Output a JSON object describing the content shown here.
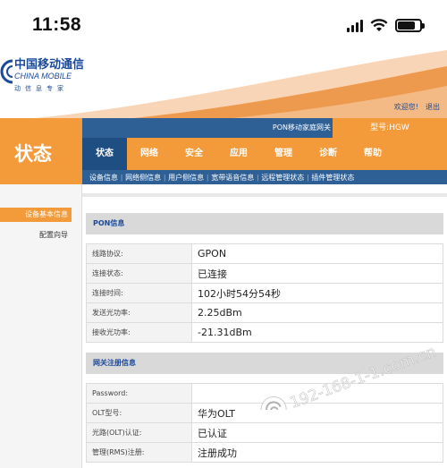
{
  "status_bar": {
    "time": "11:58"
  },
  "header": {
    "logo_cn": "中国移动通信",
    "logo_en": "CHINA MOBILE",
    "logo_slogan": "动信息专家",
    "welcome": "欢迎您!",
    "logout": "退出"
  },
  "top_strip": {
    "device_name": "PON移动家庭网关",
    "model": "型号:HGW"
  },
  "page_title": "状态",
  "main_nav": [
    "状态",
    "网络",
    "安全",
    "应用",
    "管理",
    "诊断",
    "帮助"
  ],
  "sub_nav": [
    "设备信息",
    "网络侧信息",
    "用户侧信息",
    "宽带语音信息",
    "远程管理状态",
    "插件管理状态"
  ],
  "sidebar": {
    "active": "设备基本信息",
    "items": [
      "配置向导"
    ]
  },
  "pon_section": {
    "title": "PON信息",
    "rows": [
      {
        "key": "线路协议:",
        "value": "GPON"
      },
      {
        "key": "连接状态:",
        "value": "已连接"
      },
      {
        "key": "连接时间:",
        "value": "102小时54分54秒"
      },
      {
        "key": "发送光功率:",
        "value": "2.25dBm"
      },
      {
        "key": "接收光功率:",
        "value": "-21.31dBm"
      }
    ]
  },
  "register_section": {
    "title": "网关注册信息",
    "rows": [
      {
        "key": "Password:",
        "value": ""
      },
      {
        "key": "OLT型号:",
        "value": "华为OLT"
      },
      {
        "key": "光路(OLT)认证:",
        "value": "已认证"
      },
      {
        "key": "管理(RMS)注册:",
        "value": "注册成功"
      }
    ]
  },
  "watermark": "192-168-1-1.com.cn",
  "colors": {
    "orange": "#f39a3a",
    "navy": "#2e5f95",
    "blue_text": "#1a4a9b"
  }
}
